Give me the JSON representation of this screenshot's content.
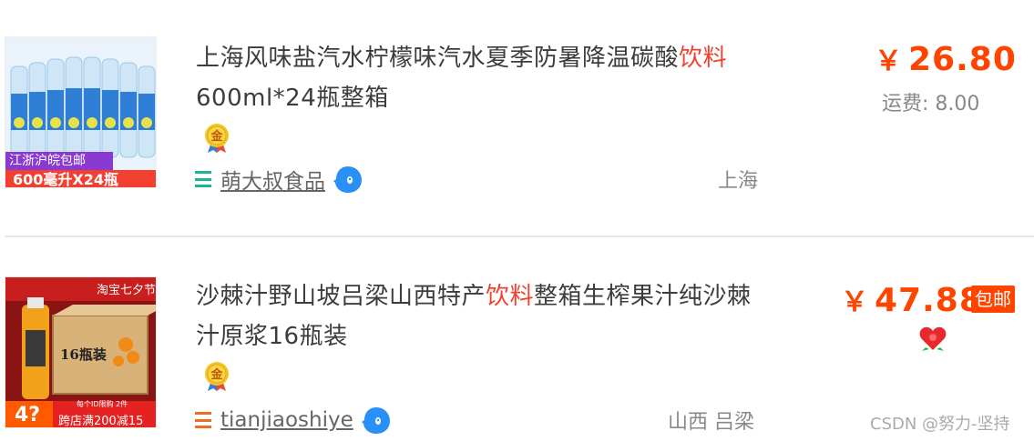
{
  "items": [
    {
      "title_before": "上海风味盐汽水柠檬味汽水夏季防暑降温碳酸",
      "title_highlight": "饮料",
      "title_after": "600ml*24瓶整箱",
      "thumb_label_top": "江浙沪皖包邮",
      "thumb_label_bottom": "600毫升X24瓶",
      "medal_text": "金",
      "shop_name": "萌大叔食品",
      "location": "上海",
      "price_currency": "￥",
      "price": "26.80",
      "shipping": "运费: 8.00",
      "accent": "#1ab394"
    },
    {
      "title_before": "沙棘汁野山坡吕梁山西特产",
      "title_highlight": "饮料",
      "title_after": "整箱生榨果汁纯沙棘汁原浆16瓶装",
      "thumb_label_top": "淘宝七夕节",
      "thumb_box_text": "16瓶装",
      "thumb_promo_price": "4?",
      "thumb_promo_note": "每个ID限购 2件",
      "thumb_promo_text": "跨店满200减15",
      "medal_text": "金",
      "shop_name": "tianjiaoshiye",
      "location": "山西 吕梁",
      "price_currency": "￥",
      "price": "47.88",
      "badge": "包邮",
      "accent": "#f26b21"
    }
  ],
  "watermark": "CSDN @努力-坚持",
  "colors": {
    "price": "#ff4400",
    "highlight": "#f23f2f",
    "text": "#3c3c3c"
  },
  "icons": [
    "menu-lines-icon",
    "wangwang-chat-icon",
    "gold-medal-icon",
    "heart-icon"
  ]
}
